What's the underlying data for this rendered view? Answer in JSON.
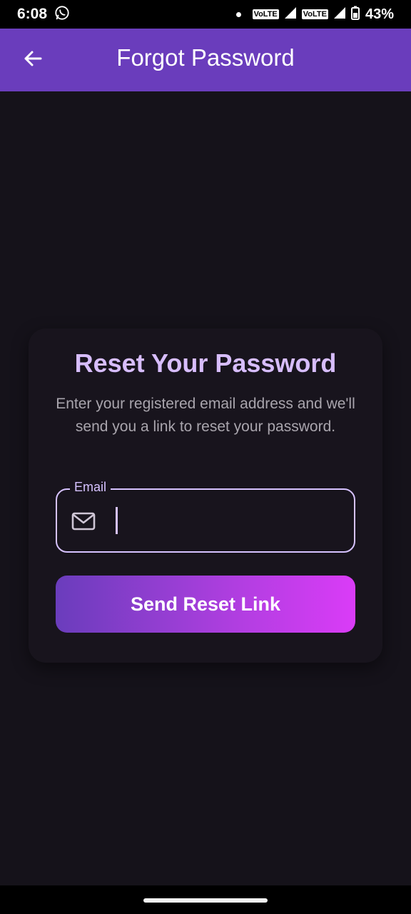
{
  "status_bar": {
    "time": "6:08",
    "network_labels": [
      "VoLTE",
      "VoLTE"
    ],
    "battery_percent": "43%",
    "icons": [
      "whatsapp-icon",
      "dot-icon",
      "signal-icon",
      "signal-icon",
      "battery-icon"
    ]
  },
  "app_bar": {
    "title": "Forgot Password",
    "back_icon": "arrow-left-icon",
    "background": "#6a3dbc"
  },
  "card": {
    "title": "Reset Your Password",
    "description": "Enter your registered email address and we'll send you a link to reset your password.",
    "email_field": {
      "label": "Email",
      "value": "",
      "icon": "mail-icon"
    },
    "submit_label": "Send Reset Link"
  },
  "colors": {
    "accent": "#d6c2ff",
    "title": "#d7bdfd",
    "background": "#15121a",
    "button_gradient": [
      "#6a3dbc",
      "#da3cf7"
    ]
  }
}
